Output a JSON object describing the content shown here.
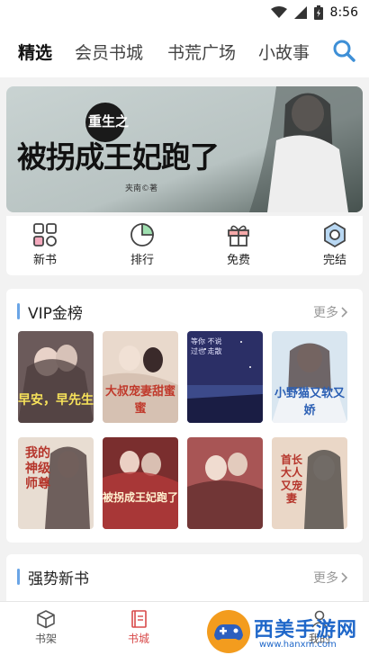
{
  "status_bar": {
    "time": "8:56"
  },
  "top_tabs": [
    "精选",
    "会员书城",
    "书荒广场",
    "小故事"
  ],
  "banner": {
    "line1": "重生之",
    "line2": "被拐成王妃跑了",
    "author": "夹南©著"
  },
  "quick_entries": [
    "新书",
    "排行",
    "免费",
    "完结"
  ],
  "vip_section": {
    "title": "VIP金榜",
    "more": "更多"
  },
  "books": [
    {
      "title": "早安，早先生",
      "bg": "#6b5a5a"
    },
    {
      "title": "大叔宠妻甜蜜蜜",
      "bg": "#e9d9cc"
    },
    {
      "title": "等你 不说过也 走散",
      "bg": "#2b2f66"
    },
    {
      "title": "小野猫又软又娇",
      "bg": "#d9e6f0"
    },
    {
      "title": "我的神级师尊",
      "bg": "#e8ddd2"
    },
    {
      "title": "被拐成王妃跑了",
      "bg": "#7a2e2e"
    },
    {
      "title": "",
      "bg": "#a85555"
    },
    {
      "title": "首长大人又宠妻",
      "bg": "#ead7c7"
    }
  ],
  "new_section": {
    "title": "强势新书",
    "more": "更多"
  },
  "bottom_nav": [
    "书架",
    "书城",
    "我的"
  ],
  "watermark": {
    "text": "西美手游网",
    "url": "www.hanxm.com"
  },
  "colors": {
    "accent_blue": "#6aa5e6",
    "active_red": "#d84a4a"
  }
}
